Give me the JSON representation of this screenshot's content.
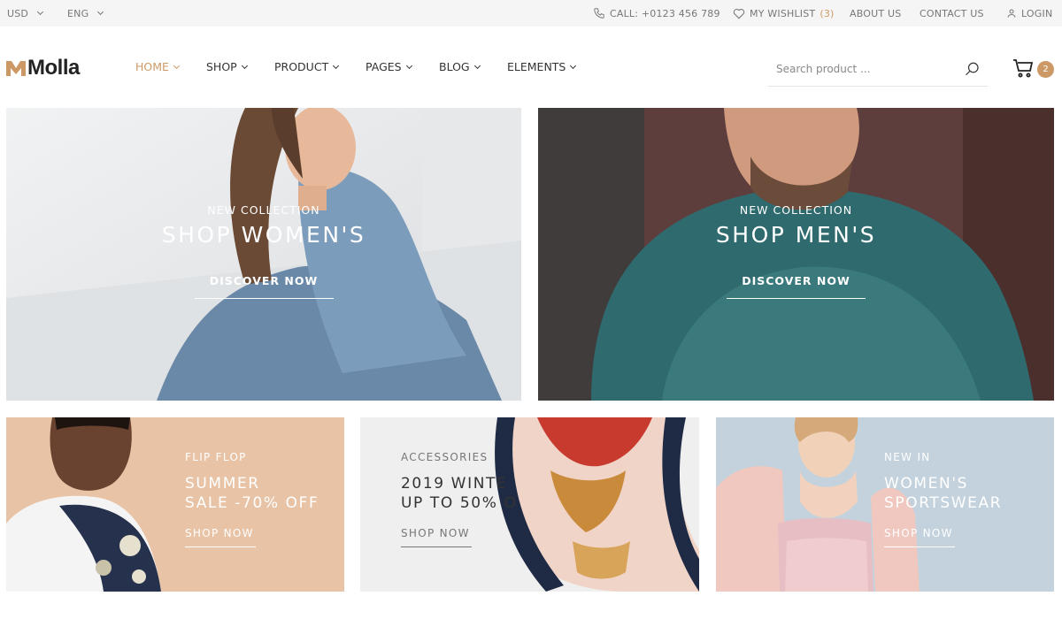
{
  "topbar": {
    "currency": "USD",
    "language": "ENG",
    "call": "CALL: +0123 456 789",
    "wishlist_label": "MY WISHLIST",
    "wishlist_count": "(3)",
    "about": "ABOUT US",
    "contact": "CONTACT US",
    "login": "LOGIN"
  },
  "header": {
    "logo_text": "Molla",
    "nav": [
      "HOME",
      "SHOP",
      "PRODUCT",
      "PAGES",
      "BLOG",
      "ELEMENTS"
    ],
    "search_placeholder": "Search product ...",
    "cart_count": "2"
  },
  "banners": {
    "women": {
      "subtitle": "NEW COLLECTION",
      "title": "SHOP WOMEN'S",
      "button": "DISCOVER NOW"
    },
    "men": {
      "subtitle": "NEW COLLECTION",
      "title": "SHOP MEN'S",
      "button": "DISCOVER NOW"
    },
    "flipflop": {
      "subtitle": "FLIP FLOP",
      "title": "SUMMER\nSALE -70% OFF",
      "button": "SHOP NOW"
    },
    "accessories": {
      "subtitle": "ACCESSORIES",
      "title": "2019 WINTE\nUP TO 50% O",
      "button": "SHOP NOW"
    },
    "sportswear": {
      "subtitle": "NEW IN",
      "title": "WOMEN'S\nSPORTSWEAR",
      "button": "SHOP NOW"
    }
  },
  "colors": {
    "accent": "#cc9966",
    "topbar_bg": "#f5f5f5",
    "banner_flipflop_bg": "#e8c3a5",
    "banner_accessories_bg": "#efefef",
    "banner_sportswear_bg": "#c3d2dc"
  },
  "icons": [
    "chevron-down-icon",
    "phone-icon",
    "heart-icon",
    "user-icon",
    "search-icon",
    "cart-icon"
  ]
}
